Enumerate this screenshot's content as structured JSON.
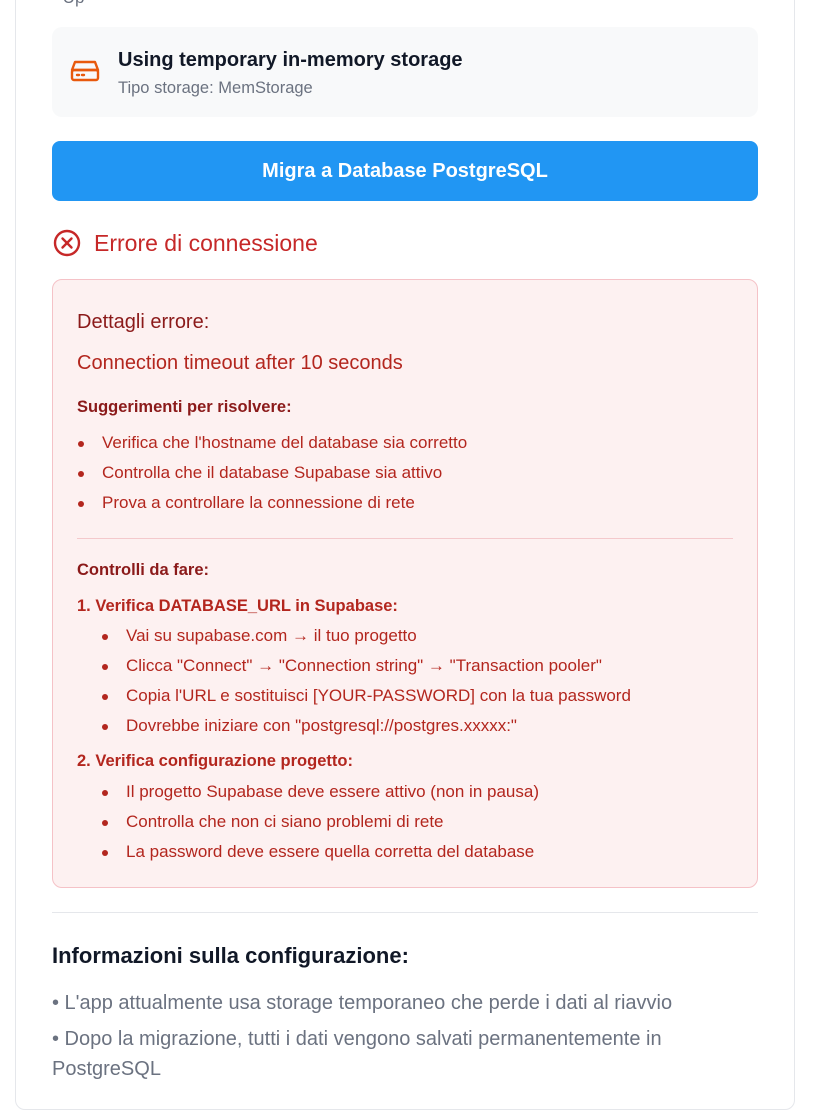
{
  "top_cut_text": "• Up",
  "storage": {
    "icon": "hard-drive-icon",
    "title": "Using temporary in-memory storage",
    "subtitle": "Tipo storage: MemStorage"
  },
  "migrate_button": {
    "label": "Migra a Database PostgreSQL",
    "color": "#2196f3"
  },
  "error": {
    "icon": "x-circle-icon",
    "title": "Errore di connessione",
    "details_heading": "Dettagli errore:",
    "message": "Connection timeout after 10 seconds",
    "suggestions_heading": "Suggerimenti per risolvere:",
    "suggestions": [
      "Verifica che l'hostname del database sia corretto",
      "Controlla che il database Supabase sia attivo",
      "Prova a controllare la connessione di rete"
    ],
    "checks_heading": "Controlli da fare:",
    "steps": [
      {
        "title": "1. Verifica DATABASE_URL in Supabase:",
        "items": [
          "Vai su supabase.com → il tuo progetto",
          "Clicca \"Connect\" → \"Connection string\" → \"Transaction pooler\"",
          "Copia l'URL e sostituisci [YOUR-PASSWORD] con la tua password",
          "Dovrebbe iniziare con \"postgresql://postgres.xxxxx:\""
        ]
      },
      {
        "title": "2. Verifica configurazione progetto:",
        "items": [
          "Il progetto Supabase deve essere attivo (non in pausa)",
          "Controlla che non ci siano problemi di rete",
          "La password deve essere quella corretta del database"
        ]
      }
    ],
    "colors": {
      "accent": "#c62828",
      "background": "#fdf1f1",
      "border": "#f5c2c7"
    }
  },
  "info": {
    "heading": "Informazioni sulla configurazione:",
    "items": [
      "• L'app attualmente usa storage temporaneo che perde i dati al riavvio",
      "• Dopo la migrazione, tutti i dati vengono salvati permanentemente in PostgreSQL"
    ]
  }
}
